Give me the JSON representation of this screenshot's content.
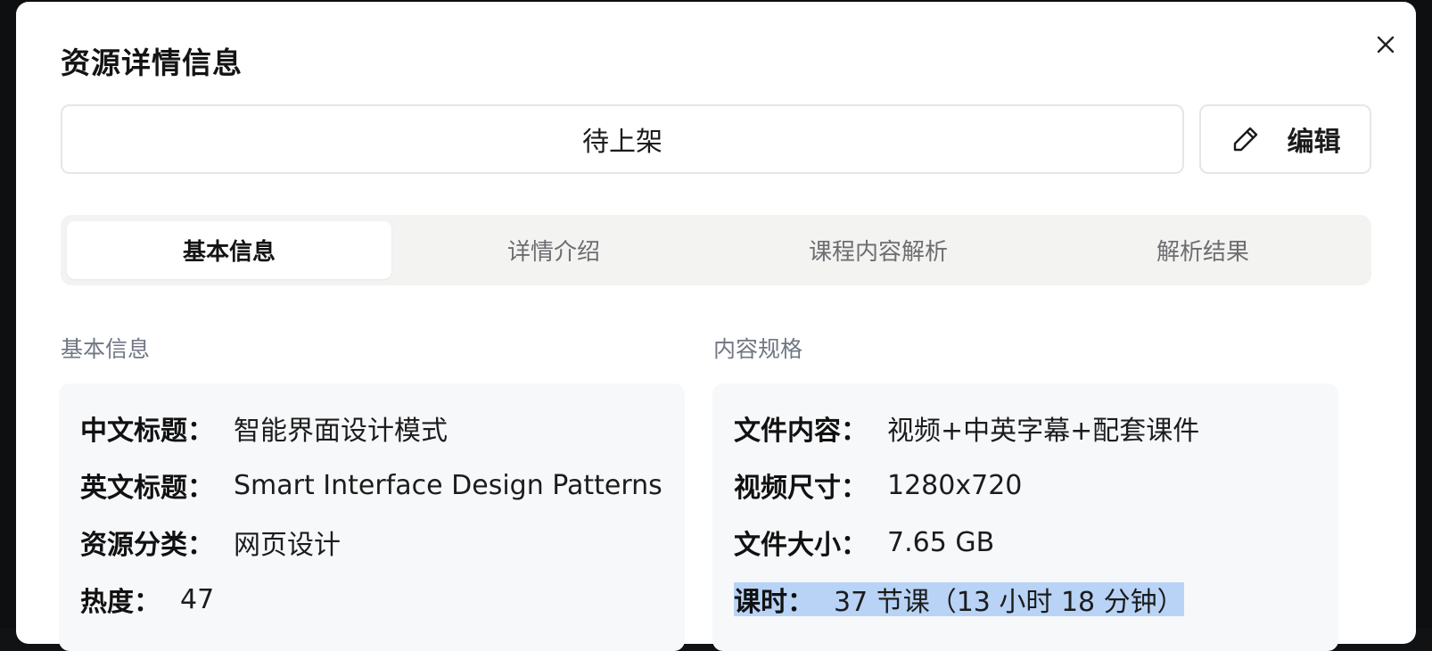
{
  "dialog": {
    "title": "资源详情信息",
    "status": "待上架",
    "edit_label": "编辑",
    "icons": {
      "close": "close-icon",
      "edit": "pencil-icon"
    }
  },
  "tabs": [
    {
      "label": "基本信息",
      "active": true
    },
    {
      "label": "详情介绍",
      "active": false
    },
    {
      "label": "课程内容解析",
      "active": false
    },
    {
      "label": "解析结果",
      "active": false
    }
  ],
  "basic_info": {
    "section_title": "基本信息",
    "rows": [
      {
        "label": "中文标题：",
        "value": "智能界面设计模式"
      },
      {
        "label": "英文标题：",
        "value": "Smart Interface Design Patterns"
      },
      {
        "label": "资源分类：",
        "value": "网页设计"
      },
      {
        "label": "热度：",
        "value": "47"
      }
    ]
  },
  "content_spec": {
    "section_title": "内容规格",
    "rows": [
      {
        "label": "文件内容：",
        "value": "视频+中英字幕+配套课件"
      },
      {
        "label": "视频尺寸：",
        "value": "1280x720"
      },
      {
        "label": "文件大小：",
        "value": "7.65 GB"
      },
      {
        "label": "课时：",
        "value": "37 节课（13 小时 18 分钟）"
      }
    ]
  },
  "colors": {
    "modal_bg": "#ffffff",
    "card_bg": "#f7f8fa",
    "tabs_bg": "#f3f3f2",
    "selection_highlight": "#b8d3f5",
    "muted_text": "#707784"
  }
}
